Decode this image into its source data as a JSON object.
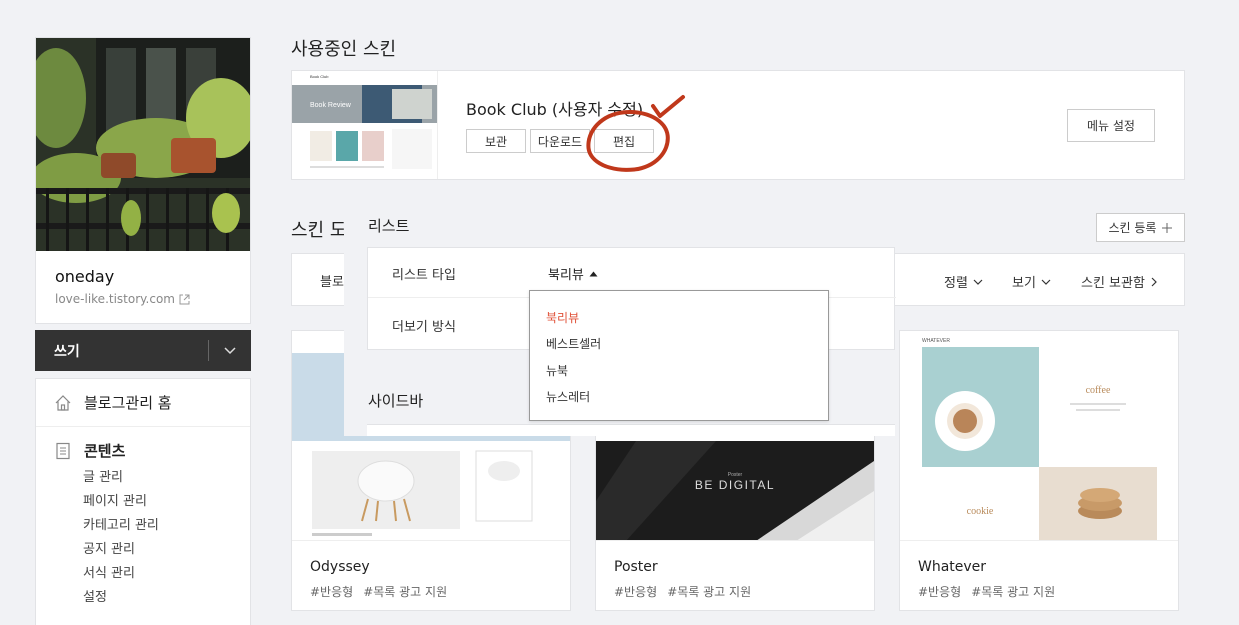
{
  "sidebar": {
    "blog_name": "oneday",
    "blog_url": "love-like.tistory.com",
    "write_label": "쓰기",
    "home_label": "블로그관리 홈",
    "content_label": "콘텐츠",
    "content_items": [
      "글 관리",
      "페이지 관리",
      "카테고리 관리",
      "공지 관리",
      "서식 관리",
      "설정"
    ]
  },
  "current_skin": {
    "heading": "사용중인 스킨",
    "name": "Book Club (사용자 수정)",
    "buttons": {
      "archive": "보관",
      "download": "다운로드",
      "edit": "편집"
    },
    "menu_settings": "메뉴 설정",
    "thumb_title": "Book Club",
    "thumb_banner": "Book Review"
  },
  "skin_store": {
    "heading_visible": "스킨 도",
    "register_label": "스킨 등록",
    "filter_left": "블로",
    "sort_label": "정렬",
    "view_label": "보기",
    "archive_label": "스킨 보관함"
  },
  "overlay": {
    "list_heading": "리스트",
    "list_type_label": "리스트 타입",
    "list_type_value": "북리뷰",
    "more_label": "더보기 방식",
    "sidebar_heading": "사이드바",
    "dropdown_options": [
      "북리뷰",
      "베스트셀러",
      "뉴북",
      "뉴스레터"
    ],
    "selected_color": "#e0533a"
  },
  "cards": [
    {
      "name": "Odyssey",
      "tags": [
        "#반응형",
        "#목록 광고 지원"
      ]
    },
    {
      "name": "Poster",
      "tags": [
        "#반응형",
        "#목록 광고 지원"
      ],
      "thumb_small": "Poster",
      "thumb_text": "BE DIGITAL"
    },
    {
      "name": "Whatever",
      "tags": [
        "#반응형",
        "#목록 광고 지원"
      ],
      "thumb_brand": "WHATEVER",
      "thumb_word1": "coffee",
      "thumb_word2": "cookie"
    }
  ],
  "colors": {
    "annotation": "#c0381b",
    "write_bar": "#333333"
  }
}
